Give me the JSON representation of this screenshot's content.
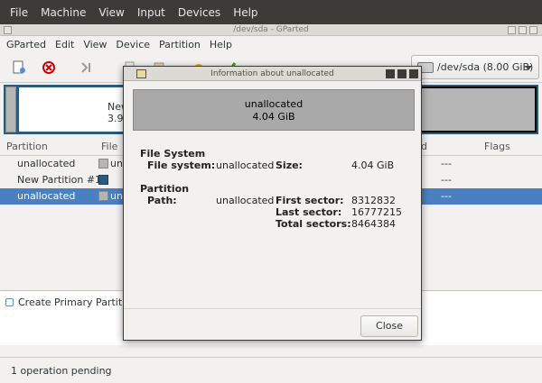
{
  "vm_menu": [
    "File",
    "Machine",
    "View",
    "Input",
    "Devices",
    "Help"
  ],
  "window": {
    "title": "/dev/sda - GParted"
  },
  "app_menu": [
    "GParted",
    "Edit",
    "View",
    "Device",
    "Partition",
    "Help"
  ],
  "device_selector": {
    "value": "/dev/sda (8.00 GiB)"
  },
  "disk_graphic": {
    "partition_label": "New",
    "partition_size": "3.91",
    "right_label": "d"
  },
  "partition_list": {
    "headers": {
      "partition": "Partition",
      "filesystem": "File",
      "d_col": "d",
      "flags": "Flags"
    },
    "rows": [
      {
        "name": "unallocated",
        "fs": "un",
        "flags": "---",
        "swatch": "#b5b5b5"
      },
      {
        "name": "New Partition #1",
        "fs": "",
        "flags": "---",
        "swatch": "#2b5a82"
      },
      {
        "name": "unallocated",
        "fs": "un",
        "flags": "---",
        "swatch": "#b5b5b5"
      }
    ]
  },
  "operations": {
    "items": [
      "Create Primary Partitio"
    ]
  },
  "status": {
    "text": "1 operation pending"
  },
  "dialog": {
    "title": "Information about unallocated",
    "banner_name": "unallocated",
    "banner_size": "4.04 GiB",
    "fs_section": "File System",
    "fs_label": "File system:",
    "fs_value": "unallocated",
    "size_label": "Size:",
    "size_value": "4.04 GiB",
    "partition_section": "Partition",
    "path_label": "Path:",
    "path_value": "unallocated",
    "first_sector_label": "First sector:",
    "first_sector_value": "8312832",
    "last_sector_label": "Last sector:",
    "last_sector_value": "16777215",
    "total_sectors_label": "Total sectors:",
    "total_sectors_value": "8464384",
    "close_label": "Close"
  }
}
